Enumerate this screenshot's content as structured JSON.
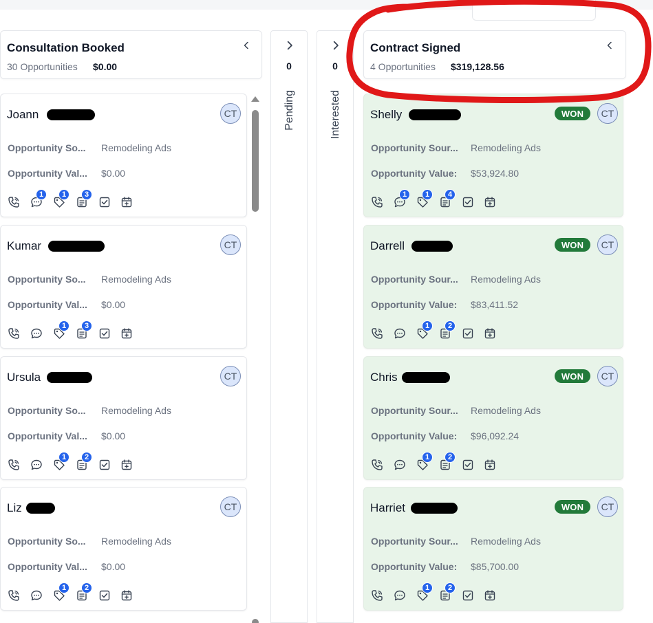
{
  "columns": {
    "consultation": {
      "title": "Consultation Booked",
      "count": "30 Opportunities",
      "value": "$0.00",
      "cards": [
        {
          "name": "Joann",
          "avatar": "CT",
          "source_label": "Opportunity So...",
          "source": "Remodeling Ads",
          "value_label": "Opportunity Val...",
          "value": "$0.00",
          "badges": {
            "chat": "1",
            "tag": "1",
            "notes": "3"
          }
        },
        {
          "name": "Kumar",
          "avatar": "CT",
          "source_label": "Opportunity So...",
          "source": "Remodeling Ads",
          "value_label": "Opportunity Val...",
          "value": "$0.00",
          "badges": {
            "tag": "1",
            "notes": "3"
          }
        },
        {
          "name": "Ursula",
          "avatar": "CT",
          "source_label": "Opportunity So...",
          "source": "Remodeling Ads",
          "value_label": "Opportunity Val...",
          "value": "$0.00",
          "badges": {
            "tag": "1",
            "notes": "2"
          }
        },
        {
          "name": "Liz",
          "avatar": "CT",
          "source_label": "Opportunity So...",
          "source": "Remodeling Ads",
          "value_label": "Opportunity Val...",
          "value": "$0.00",
          "badges": {
            "tag": "1",
            "notes": "2"
          }
        }
      ]
    },
    "pending": {
      "title": "Pending",
      "count": "0"
    },
    "interested": {
      "title": "Interested",
      "count": "0"
    },
    "contract": {
      "title": "Contract Signed",
      "count": "4 Opportunities",
      "value": "$319,128.56",
      "cards": [
        {
          "name": "Shelly",
          "avatar": "CT",
          "status": "WON",
          "source_label": "Opportunity Sour...",
          "source": "Remodeling Ads",
          "value_label": "Opportunity Value:",
          "value": "$53,924.80",
          "badges": {
            "chat": "1",
            "tag": "1",
            "notes": "4"
          }
        },
        {
          "name": "Darrell",
          "avatar": "CT",
          "status": "WON",
          "source_label": "Opportunity Sour...",
          "source": "Remodeling Ads",
          "value_label": "Opportunity Value:",
          "value": "$83,411.52",
          "badges": {
            "tag": "1",
            "notes": "2"
          }
        },
        {
          "name": "Chris",
          "avatar": "CT",
          "status": "WON",
          "source_label": "Opportunity Sour...",
          "source": "Remodeling Ads",
          "value_label": "Opportunity Value:",
          "value": "$96,092.24",
          "badges": {
            "tag": "1",
            "notes": "2"
          }
        },
        {
          "name": "Harriet",
          "avatar": "CT",
          "status": "WON",
          "source_label": "Opportunity Sour...",
          "source": "Remodeling Ads",
          "value_label": "Opportunity Value:",
          "value": "$85,700.00",
          "badges": {
            "tag": "1",
            "notes": "2"
          }
        }
      ]
    }
  },
  "icons": [
    "phone-icon",
    "chat-icon",
    "tag-icon",
    "notes-icon",
    "task-icon",
    "calendar-icon"
  ],
  "colors": {
    "won_green": "#227a3a",
    "won_card_bg": "#e8f4e9",
    "badge_blue": "#2563eb",
    "annotation_red": "#e01818"
  }
}
